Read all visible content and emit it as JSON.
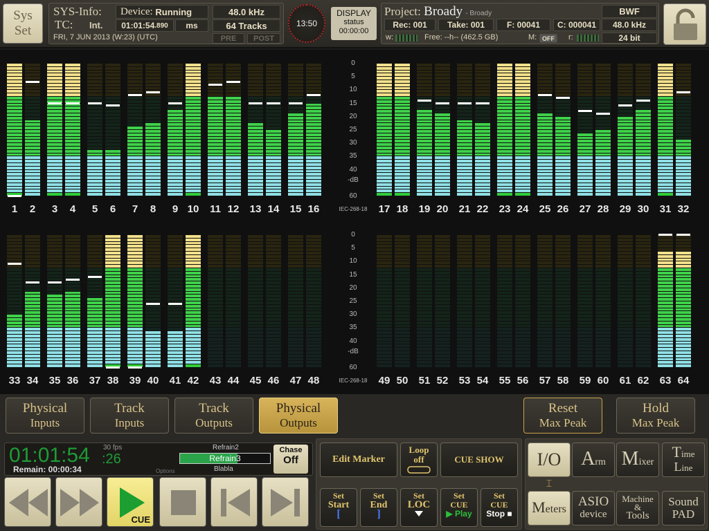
{
  "top": {
    "sysset": [
      "Sys",
      "Set"
    ],
    "sysinfo_label": "SYS-Info:",
    "device_label": "Device:",
    "device_status": "Running",
    "samplerate": "48.0 kHz",
    "tc_label": "TC:",
    "tc_mode": "Int.",
    "tc_value": "01:01:54",
    "tc_ms": ".890",
    "tc_unit": "ms",
    "tracks": "64 Tracks",
    "date": "FRI, 7 JUN 2013 (W:23) (UTC)",
    "pre": "PRE",
    "post": "POST",
    "clock": "13:50",
    "display": {
      "l1": "DISPLAY",
      "l2": "status",
      "l3": "00:00:00"
    },
    "project_label": "Project:",
    "project_name": "Broady",
    "project_sub": "- Broady",
    "format": "BWF",
    "rec": "Rec: 001",
    "take": "Take: 001",
    "file": "F: 00041",
    "clip": "C: 000041",
    "proj_rate": "48.0 kHz",
    "bitdepth": "24 bit",
    "w_label": "w:",
    "free": "Free: --h-- (462.5 GB)",
    "m_label": "M:",
    "m_value": "OFF",
    "r_label": "r:"
  },
  "scale": [
    "0",
    "5",
    "10",
    "15",
    "20",
    "25",
    "30",
    "35",
    "40",
    "-dB",
    "60"
  ],
  "iec": "IEC-268-18",
  "channels_top": [
    {
      "n": "1",
      "lvl": 0,
      "pk": 60
    },
    {
      "n": "2",
      "lvl": 21,
      "pk": 7
    },
    {
      "n": "3",
      "lvl": 0,
      "pk": 15
    },
    {
      "n": "4",
      "lvl": 0,
      "pk": 15
    },
    {
      "n": "5",
      "lvl": 32,
      "pk": 15
    },
    {
      "n": "6",
      "lvl": 32,
      "pk": 16
    },
    {
      "n": "7",
      "lvl": 23,
      "pk": 12
    },
    {
      "n": "8",
      "lvl": 22,
      "pk": 11
    },
    {
      "n": "9",
      "lvl": 17,
      "pk": 15
    },
    {
      "n": "10",
      "lvl": 0,
      "pk": null
    },
    {
      "n": "11",
      "lvl": 12,
      "pk": 8
    },
    {
      "n": "12",
      "lvl": 12,
      "pk": 7
    },
    {
      "n": "13",
      "lvl": 22,
      "pk": 15
    },
    {
      "n": "14",
      "lvl": 24,
      "pk": 15
    },
    {
      "n": "15",
      "lvl": 18,
      "pk": 15
    },
    {
      "n": "16",
      "lvl": 15,
      "pk": 12
    },
    {
      "n": "17",
      "lvl": 0,
      "pk": null
    },
    {
      "n": "18",
      "lvl": 0,
      "pk": null
    },
    {
      "n": "19",
      "lvl": 17,
      "pk": 14
    },
    {
      "n": "20",
      "lvl": 18,
      "pk": 15
    },
    {
      "n": "21",
      "lvl": 21,
      "pk": 15
    },
    {
      "n": "22",
      "lvl": 22,
      "pk": 15
    },
    {
      "n": "23",
      "lvl": 0,
      "pk": null
    },
    {
      "n": "24",
      "lvl": 0,
      "pk": null
    },
    {
      "n": "25",
      "lvl": 18,
      "pk": 12
    },
    {
      "n": "26",
      "lvl": 20,
      "pk": 13
    },
    {
      "n": "27",
      "lvl": 26,
      "pk": 18
    },
    {
      "n": "28",
      "lvl": 25,
      "pk": 19
    },
    {
      "n": "29",
      "lvl": 19,
      "pk": 16
    },
    {
      "n": "30",
      "lvl": 17,
      "pk": 14
    },
    {
      "n": "31",
      "lvl": 0,
      "pk": null
    },
    {
      "n": "32",
      "lvl": 28,
      "pk": 11
    }
  ],
  "channels_bottom": [
    {
      "n": "33",
      "lvl": 30,
      "pk": 11
    },
    {
      "n": "34",
      "lvl": 21,
      "pk": 18
    },
    {
      "n": "35",
      "lvl": 22,
      "pk": 18
    },
    {
      "n": "36",
      "lvl": 21,
      "pk": 17
    },
    {
      "n": "37",
      "lvl": 23,
      "pk": 16
    },
    {
      "n": "38",
      "lvl": 0,
      "pk": 60
    },
    {
      "n": "39",
      "lvl": 0,
      "pk": 60
    },
    {
      "n": "40",
      "lvl": 36,
      "pk": 26
    },
    {
      "n": "41",
      "lvl": 36,
      "pk": 26
    },
    {
      "n": "42",
      "lvl": 0,
      "pk": null
    },
    {
      "n": "43",
      "lvl": -1,
      "pk": null
    },
    {
      "n": "44",
      "lvl": -1,
      "pk": null
    },
    {
      "n": "45",
      "lvl": -1,
      "pk": null
    },
    {
      "n": "46",
      "lvl": -1,
      "pk": null
    },
    {
      "n": "47",
      "lvl": -1,
      "pk": null
    },
    {
      "n": "48",
      "lvl": -1,
      "pk": null
    },
    {
      "n": "49",
      "lvl": -1,
      "pk": null
    },
    {
      "n": "50",
      "lvl": -1,
      "pk": null
    },
    {
      "n": "51",
      "lvl": -1,
      "pk": null
    },
    {
      "n": "52",
      "lvl": -1,
      "pk": null
    },
    {
      "n": "53",
      "lvl": -1,
      "pk": null
    },
    {
      "n": "54",
      "lvl": -1,
      "pk": null
    },
    {
      "n": "55",
      "lvl": -1,
      "pk": null
    },
    {
      "n": "56",
      "lvl": -1,
      "pk": null
    },
    {
      "n": "57",
      "lvl": -1,
      "pk": null
    },
    {
      "n": "58",
      "lvl": -1,
      "pk": null
    },
    {
      "n": "59",
      "lvl": -1,
      "pk": null
    },
    {
      "n": "60",
      "lvl": -1,
      "pk": null
    },
    {
      "n": "61",
      "lvl": -1,
      "pk": null
    },
    {
      "n": "62",
      "lvl": -1,
      "pk": null
    },
    {
      "n": "63",
      "lvl": 6,
      "pk": 0
    },
    {
      "n": "64",
      "lvl": 6,
      "pk": 0
    }
  ],
  "tabs": {
    "physical_inputs": [
      "Physical",
      "Inputs"
    ],
    "track_inputs": [
      "Track",
      "Inputs"
    ],
    "track_outputs": [
      "Track",
      "Outputs"
    ],
    "physical_outputs": [
      "Physical",
      "Outputs"
    ],
    "reset_max": [
      "Reset",
      "Max Peak"
    ],
    "hold_max": [
      "Hold",
      "Max Peak"
    ]
  },
  "transport": {
    "timecode": "01:01:54",
    "frames": ":26",
    "fps": "30 fps",
    "remain": "Remain: 00:00:34",
    "options": "Options",
    "marker_prev": "Refrain2",
    "marker_cur": "Refrain3",
    "marker_next": "Blabla",
    "chase_label": "Chase",
    "chase_value": "Off",
    "cue": "CUE"
  },
  "center": {
    "edit_marker": "Edit Marker",
    "loop": [
      "Loop",
      "off"
    ],
    "cue_show": "CUE SHOW",
    "set_start": [
      "Set",
      "Start",
      "["
    ],
    "set_end": [
      "Set",
      "End",
      "]"
    ],
    "set_loc": [
      "Set",
      "LOC"
    ],
    "set_cue_play": [
      "Set",
      "CUE",
      "Play"
    ],
    "set_cue_stop": [
      "Set",
      "CUE",
      "Stop"
    ]
  },
  "right": {
    "io": "I/O",
    "arm": [
      "A",
      "rm"
    ],
    "mixer": [
      "M",
      "ixer"
    ],
    "timeline": [
      "T",
      "ime",
      "L",
      "ine"
    ],
    "meters": [
      "M",
      "eters"
    ],
    "asio": [
      "ASIO",
      "device"
    ],
    "machine": [
      "Machine",
      "&",
      "Tools"
    ],
    "sound": [
      "Sound",
      "PAD"
    ]
  }
}
